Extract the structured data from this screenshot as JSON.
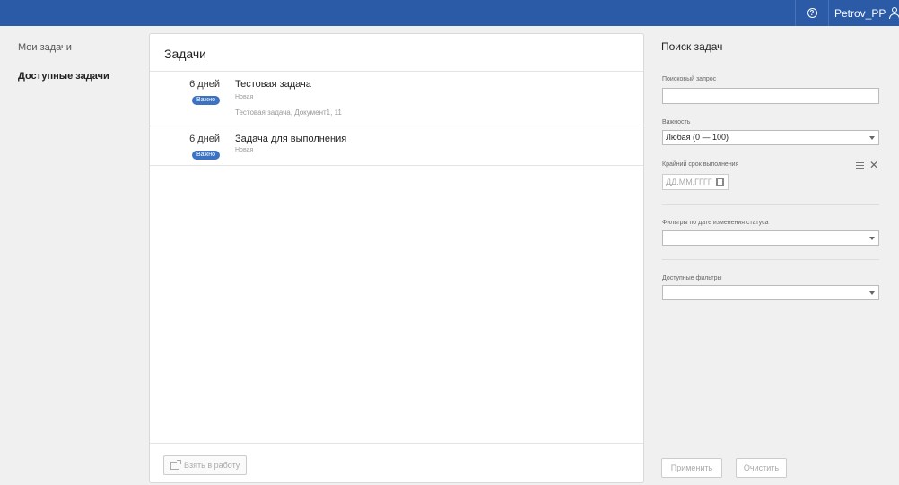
{
  "header": {
    "help_icon": "question-circle-icon",
    "username": "Petrov_PP",
    "user_icon": "user-icon"
  },
  "leftnav": {
    "items": [
      {
        "label": "Мои задачи",
        "active": false
      },
      {
        "label": "Доступные задачи",
        "active": true
      }
    ]
  },
  "tasks_panel": {
    "title": "Задачи",
    "tasks": [
      {
        "days": "6 дней",
        "badge": "Важно",
        "name": "Тестовая задача",
        "status": "Новая",
        "description": "Тестовая задача, Документ1, 11"
      },
      {
        "days": "6 дней",
        "badge": "Важно",
        "name": "Задача для выполнения",
        "status": "Новая",
        "description": ""
      }
    ],
    "take_button": "Взять в работу"
  },
  "search_panel": {
    "title": "Поиск задач",
    "query_label": "Поисковый запрос",
    "query_value": "",
    "importance_label": "Важность",
    "importance_value": "Любая (0 — 100)",
    "deadline_label": "Крайний срок выполнения",
    "deadline_placeholder": "ДД.ММ.ГГГГ",
    "status_date_filter_label": "Фильтры по дате изменения статуса",
    "status_date_filter_value": "",
    "available_filters_label": "Доступные фильтры",
    "available_filters_value": "",
    "apply_button": "Применить",
    "clear_button": "Очистить"
  },
  "colors": {
    "topbar": "#2b5aa6",
    "badge": "#3b72c2"
  }
}
